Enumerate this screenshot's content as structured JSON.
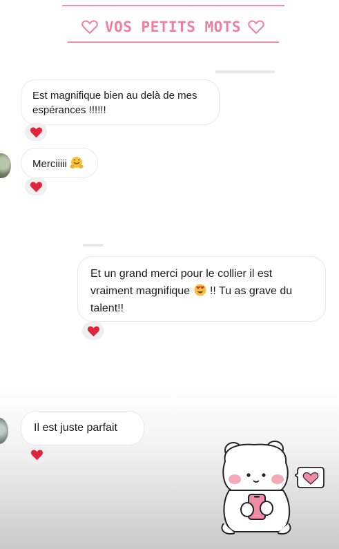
{
  "header": {
    "title": "VOS PETITS MOTS",
    "left_icon": "heart-outline-icon",
    "right_icon": "heart-outline-icon",
    "accent_color": "#ef7ea3"
  },
  "messages": [
    {
      "id": "m1",
      "sender": "other",
      "text": "Est magnifique bien au delà de mes espérances !!!!!!",
      "reaction": "red-heart-icon"
    },
    {
      "id": "m2",
      "sender": "other",
      "text": "Merciiiii",
      "emoji": "smiling-face-with-open-hands-icon",
      "reaction": "red-heart-icon"
    },
    {
      "id": "m3",
      "sender": "me",
      "text_before": "Et un grand merci pour le collier il est vraiment magnifique",
      "emoji": "heart-eyes-icon",
      "text_after": "!! Tu as grave du talent!!",
      "reaction": "red-heart-icon"
    },
    {
      "id": "m4",
      "sender": "other",
      "text": "Il est juste parfait",
      "reaction": "red-heart-icon"
    }
  ],
  "sticker": {
    "name": "bear-with-phone-sticker",
    "speech_icon": "pink-heart-speech-bubble-icon"
  },
  "colors": {
    "heart_red": "#e0243a",
    "sticker_pink": "#f08aa8"
  }
}
